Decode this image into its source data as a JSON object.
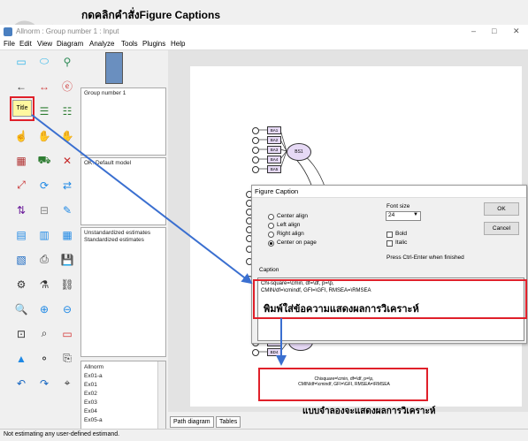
{
  "annotations": {
    "top_instruction": "กดคลิกคำสั่งFigure Captions",
    "caption_instruction": "พิมพ์ใส่ข้อความแสดงผลการวิเคราะห์",
    "model_note": "แบบจำลองจะแสดงผลการวิเคราะห์",
    "accent_color": "#e0202a"
  },
  "watermark": {
    "text": "อมเกล้าคุณ"
  },
  "window": {
    "title": "Allnorm : Group number 1 : Input",
    "controls": [
      "–",
      "□",
      "✕"
    ]
  },
  "menu": [
    "File",
    "Edit",
    "View",
    "Diagram",
    "Analyze",
    "Tools",
    "Plugins",
    "Help"
  ],
  "panels": {
    "group": "Group number 1",
    "model": "OK: Default model",
    "estimates": [
      "Unstandardized estimates",
      "Standardized estimates"
    ],
    "files": [
      "Allnorm",
      "Ex01-a",
      "Ex01",
      "Ex02",
      "Ex03",
      "Ex04",
      "Ex05-a"
    ]
  },
  "tabs": [
    "Path diagram",
    "Tables"
  ],
  "status": "Not estimating any user-defined estimand.",
  "diagram": {
    "latent_top": "BS1",
    "latent_bottom": "BD4",
    "top_indicators": [
      "BA1",
      "BA2",
      "BA3",
      "BA4",
      "BA5"
    ],
    "bottom_indicators": [
      "BD1",
      "BD2",
      "BD3",
      "BD4"
    ],
    "output_line1": "Chisquare=\\cmin, df=\\df, p=\\p,",
    "output_line2": "CMIN/df=\\cmindf, GFI=\\GFI, RMSEA=\\RMSEA"
  },
  "dialog": {
    "title": "Figure Caption",
    "alignments": [
      {
        "label": "Center align",
        "selected": false
      },
      {
        "label": "Left align",
        "selected": false
      },
      {
        "label": "Right align",
        "selected": false
      },
      {
        "label": "Center on page",
        "selected": true
      }
    ],
    "font_size_label": "Font size",
    "font_size": "24",
    "bold": "Bold",
    "italic": "Italic",
    "hint": "Press Ctrl-Enter when finished",
    "ok": "OK",
    "cancel": "Cancel",
    "caption_label": "Caption",
    "caption_line1": "Chi-square=\\cmin, df=\\df, p=\\p,",
    "caption_line2": "CMIN/df=\\cmindf, GFI=\\GFI, RMSEA=\\RMSEA"
  },
  "tools": [
    "rect-icon",
    "ellipse-icon",
    "indicator-icon",
    "arrow-icon",
    "double-arrow-icon",
    "error-icon",
    "title-icon",
    "list-variables-icon",
    "list-data-icon",
    "select-one-icon",
    "select-all-icon",
    "deselect-icon",
    "copy-icon",
    "move-icon",
    "erase-icon",
    "resize-icon",
    "rotate-icon",
    "reflect-icon",
    "move-params-icon",
    "reposition-icon",
    "touch-up-icon",
    "data-file-icon",
    "analysis-props-icon",
    "calculate-icon",
    "view-text-icon",
    "print-icon",
    "save-icon",
    "object-props-icon",
    "drag-props-icon",
    "preserve-symmetry-icon",
    "zoom-area-icon",
    "zoom-in-icon",
    "zoom-out-icon",
    "fit-page-icon",
    "magnify-icon",
    "page-icon",
    "bayesian-icon",
    "multiple-group-icon",
    "copy-clipboard-icon",
    "undo-icon",
    "redo-icon",
    "search-icon"
  ],
  "title_tool_label": "Title"
}
